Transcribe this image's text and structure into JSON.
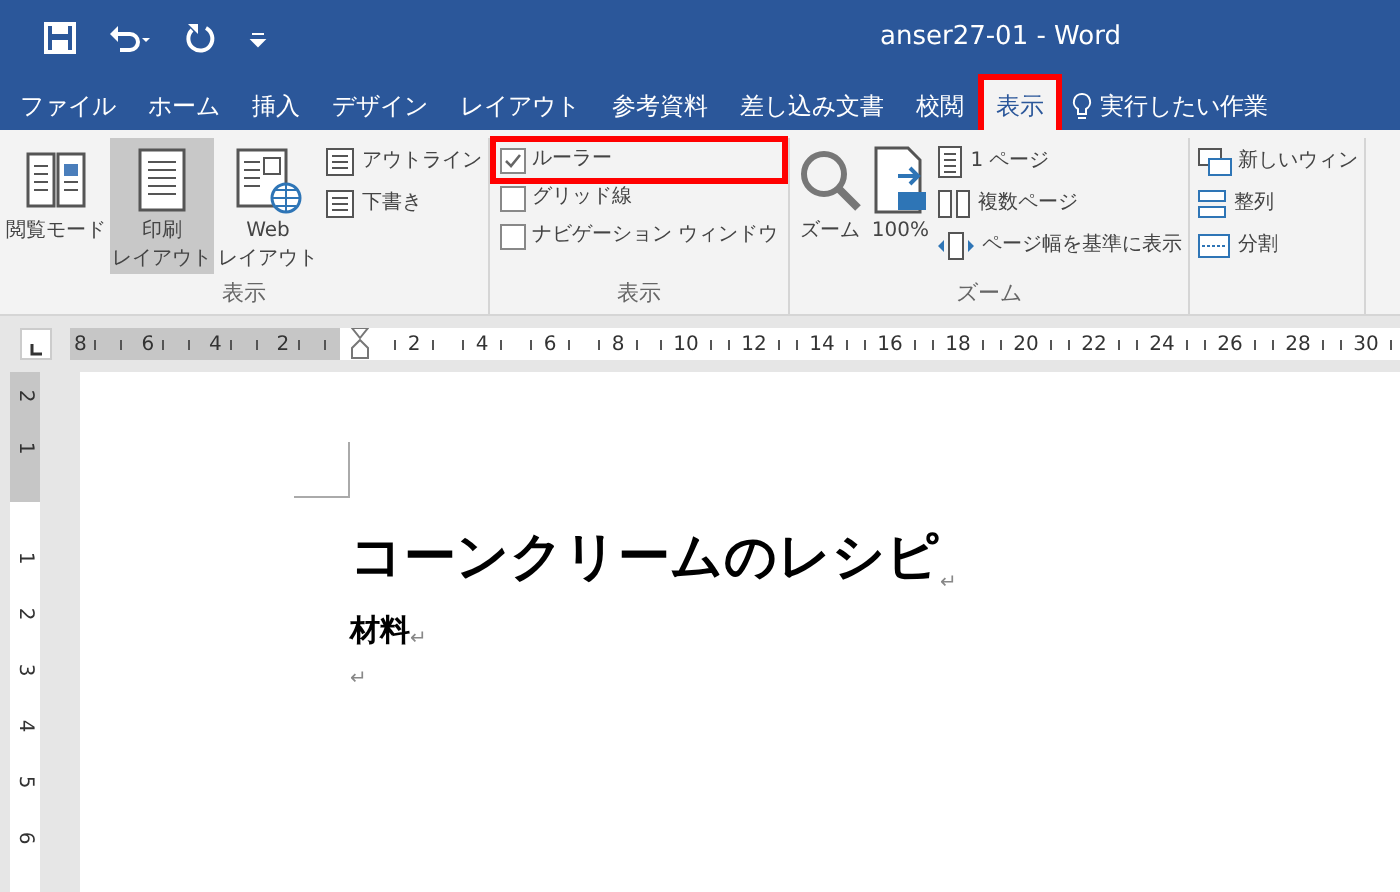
{
  "title_bar": {
    "title": "anser27-01 - Word"
  },
  "tabs": [
    {
      "label": "ファイル",
      "selected": false,
      "highlighted": false
    },
    {
      "label": "ホーム",
      "selected": false,
      "highlighted": false
    },
    {
      "label": "挿入",
      "selected": false,
      "highlighted": false
    },
    {
      "label": "デザイン",
      "selected": false,
      "highlighted": false
    },
    {
      "label": "レイアウト",
      "selected": false,
      "highlighted": false
    },
    {
      "label": "参考資料",
      "selected": false,
      "highlighted": false
    },
    {
      "label": "差し込み文書",
      "selected": false,
      "highlighted": false
    },
    {
      "label": "校閲",
      "selected": false,
      "highlighted": false
    },
    {
      "label": "表示",
      "selected": true,
      "highlighted": true
    }
  ],
  "tell_me": {
    "text": "実行したい作業"
  },
  "ribbon": {
    "groups": [
      {
        "label": "表示",
        "items": [
          {
            "kind": "large",
            "lines": [
              "閲覧モード"
            ],
            "selected": false
          },
          {
            "kind": "large",
            "lines": [
              "印刷",
              "レイアウト"
            ],
            "selected": true
          },
          {
            "kind": "large",
            "lines": [
              "Web",
              "レイアウト"
            ],
            "selected": false
          },
          {
            "kind": "small",
            "label": "アウトライン"
          },
          {
            "kind": "small",
            "label": "下書き"
          }
        ]
      },
      {
        "label": "表示",
        "items": [
          {
            "kind": "checkbox",
            "label": "ルーラー",
            "checked": true,
            "highlighted": true
          },
          {
            "kind": "checkbox",
            "label": "グリッド線",
            "checked": false,
            "highlighted": false
          },
          {
            "kind": "checkbox",
            "label": "ナビゲーション ウィンドウ",
            "checked": false,
            "highlighted": false
          }
        ]
      },
      {
        "label": "ズーム",
        "items": [
          {
            "kind": "large",
            "lines": [
              "ズーム"
            ],
            "selected": false
          },
          {
            "kind": "large",
            "lines": [
              "100%"
            ],
            "selected": false
          },
          {
            "kind": "small",
            "label": "1 ページ"
          },
          {
            "kind": "small",
            "label": "複数ページ"
          },
          {
            "kind": "small",
            "label": "ページ幅を基準に表示"
          }
        ]
      },
      {
        "items": [
          {
            "kind": "small",
            "label": "新しいウィン"
          },
          {
            "kind": "small",
            "label": "整列"
          },
          {
            "kind": "small",
            "label": "分割"
          }
        ]
      }
    ]
  },
  "ruler": {
    "left_labels": [
      "8",
      "6",
      "4",
      "2"
    ],
    "right_labels": [
      "2",
      "4",
      "6",
      "8",
      "10",
      "12",
      "14",
      "16",
      "18",
      "20",
      "22",
      "24",
      "26",
      "28",
      "30"
    ]
  },
  "vertical_ruler": {
    "top_labels": [
      "2",
      "1"
    ],
    "labels": [
      "1",
      "2",
      "3",
      "4",
      "5",
      "6"
    ]
  },
  "document": {
    "paragraphs": [
      {
        "kind": "heading",
        "text": "コーンクリームのレシピ",
        "mark": "↵"
      },
      {
        "kind": "bold",
        "text": "材料",
        "mark": "↵"
      },
      {
        "kind": "empty",
        "mark": "↵"
      }
    ]
  }
}
